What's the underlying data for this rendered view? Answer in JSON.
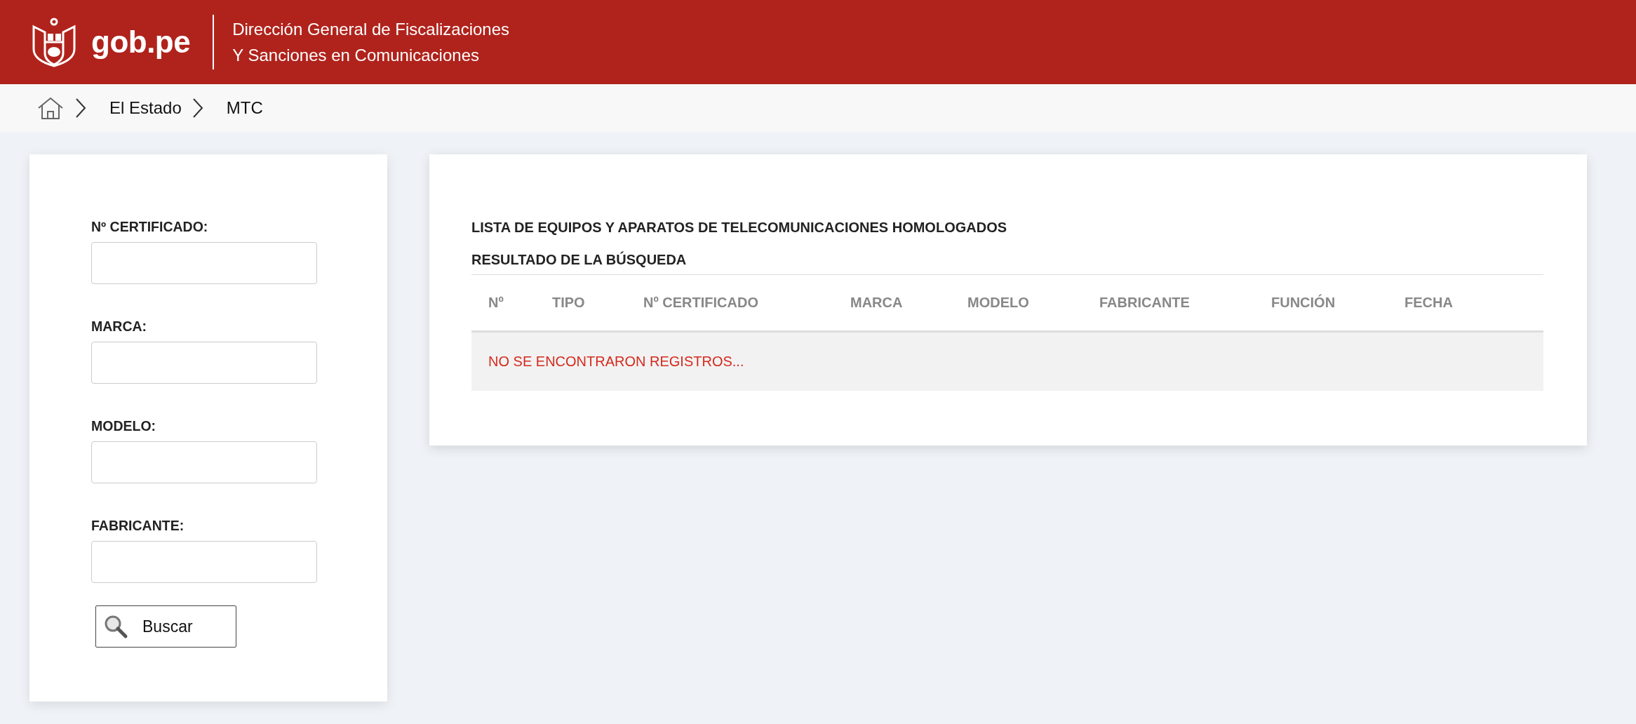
{
  "header": {
    "logo_text": "gob.pe",
    "title_lines": [
      "Dirección General de Fiscalizaciones",
      "Y Sanciones en Comunicaciones"
    ]
  },
  "breadcrumb": [
    "El Estado",
    "MTC"
  ],
  "form": {
    "fields": [
      {
        "label": "Nº CERTIFICADO:"
      },
      {
        "label": "MARCA:"
      },
      {
        "label": "MODELO:"
      },
      {
        "label": "FABRICANTE:"
      }
    ],
    "button": "Buscar"
  },
  "results": {
    "title": "LISTA DE EQUIPOS Y APARATOS DE TELECOMUNICACIONES HOMOLOGADOS",
    "subtitle": "RESULTADO DE LA BÚSQUEDA",
    "table": {
      "columns": [
        "Nº",
        "TIPO",
        "Nº CERTIFICADO",
        "MARCA",
        "MODELO",
        "FABRICANTE",
        "FUNCIÓN",
        "FECHA"
      ],
      "empty_message": "NO SE ENCONTRARON REGISTROS..."
    }
  }
}
